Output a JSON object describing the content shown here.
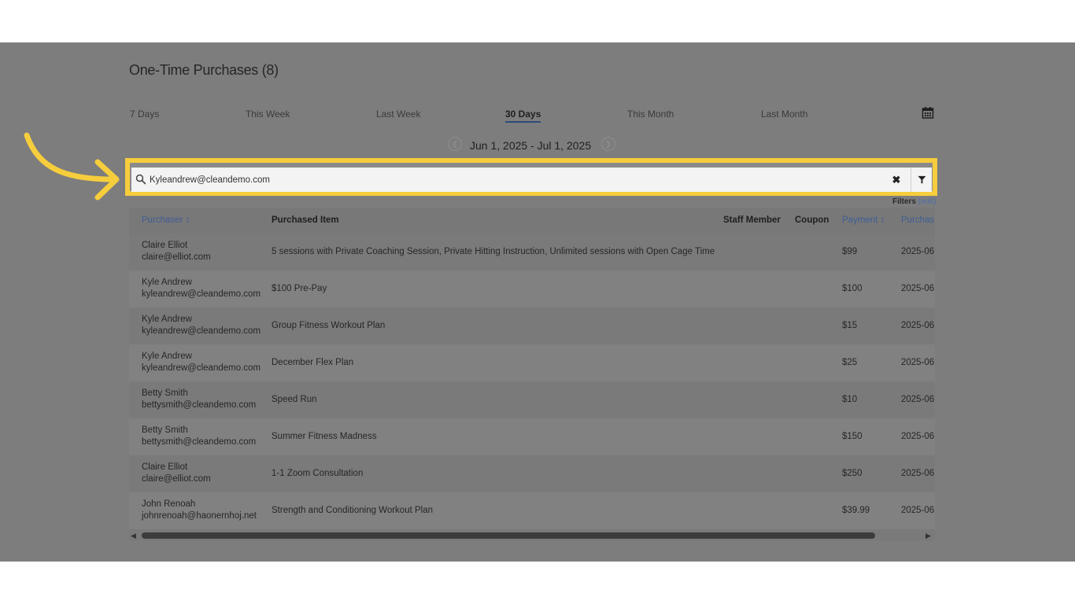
{
  "header": {
    "title": "One-Time Purchases (8)"
  },
  "tabs": [
    {
      "label": "7 Days",
      "active": false
    },
    {
      "label": "This Week",
      "active": false
    },
    {
      "label": "Last Week",
      "active": false
    },
    {
      "label": "30 Days",
      "active": true
    },
    {
      "label": "This Month",
      "active": false
    },
    {
      "label": "Last Month",
      "active": false
    }
  ],
  "date_range": {
    "label": "Jun 1, 2025 - Jul 1, 2025"
  },
  "search": {
    "value": "Kyleandrew@cleandemo.com"
  },
  "filters": {
    "label": "Filters",
    "edit_label": "(edit)"
  },
  "table": {
    "columns": [
      "Purchaser",
      "Purchased Item",
      "Staff Member",
      "Coupon",
      "Payment",
      "Purchas"
    ],
    "rows": [
      {
        "name": "Claire Elliot",
        "email": "claire@elliot.com",
        "item": "5 sessions with Private Coaching Session, Private Hitting Instruction, Unlimited sessions with Open Cage Time",
        "payment": "$99",
        "date": "2025-06"
      },
      {
        "name": "Kyle Andrew",
        "email": "kyleandrew@cleandemo.com",
        "item": "$100 Pre-Pay",
        "payment": "$100",
        "date": "2025-06"
      },
      {
        "name": "Kyle Andrew",
        "email": "kyleandrew@cleandemo.com",
        "item": "Group Fitness Workout Plan",
        "payment": "$15",
        "date": "2025-06"
      },
      {
        "name": "Kyle Andrew",
        "email": "kyleandrew@cleandemo.com",
        "item": "December Flex Plan",
        "payment": "$25",
        "date": "2025-06"
      },
      {
        "name": "Betty Smith",
        "email": "bettysmith@cleandemo.com",
        "item": "Speed Run",
        "payment": "$10",
        "date": "2025-06"
      },
      {
        "name": "Betty Smith",
        "email": "bettysmith@cleandemo.com",
        "item": "Summer Fitness Madness",
        "payment": "$150",
        "date": "2025-06"
      },
      {
        "name": "Claire Elliot",
        "email": "claire@elliot.com",
        "item": "1-1 Zoom Consultation",
        "payment": "$250",
        "date": "2025-06"
      },
      {
        "name": "John Renoah",
        "email": "johnrenoah@haonernhoj.net",
        "item": "Strength and Conditioning Workout Plan",
        "payment": "$39.99",
        "date": "2025-06"
      }
    ]
  },
  "colors": {
    "highlight": "#f6cd3c",
    "sort_link": "#3f5d95",
    "overlay": "#7d7d7d"
  },
  "icons": [
    "search-icon",
    "close-icon",
    "filter-icon",
    "calendar-icon",
    "chevron-left-icon",
    "chevron-right-icon",
    "sort-icon",
    "curved-arrow-icon"
  ]
}
